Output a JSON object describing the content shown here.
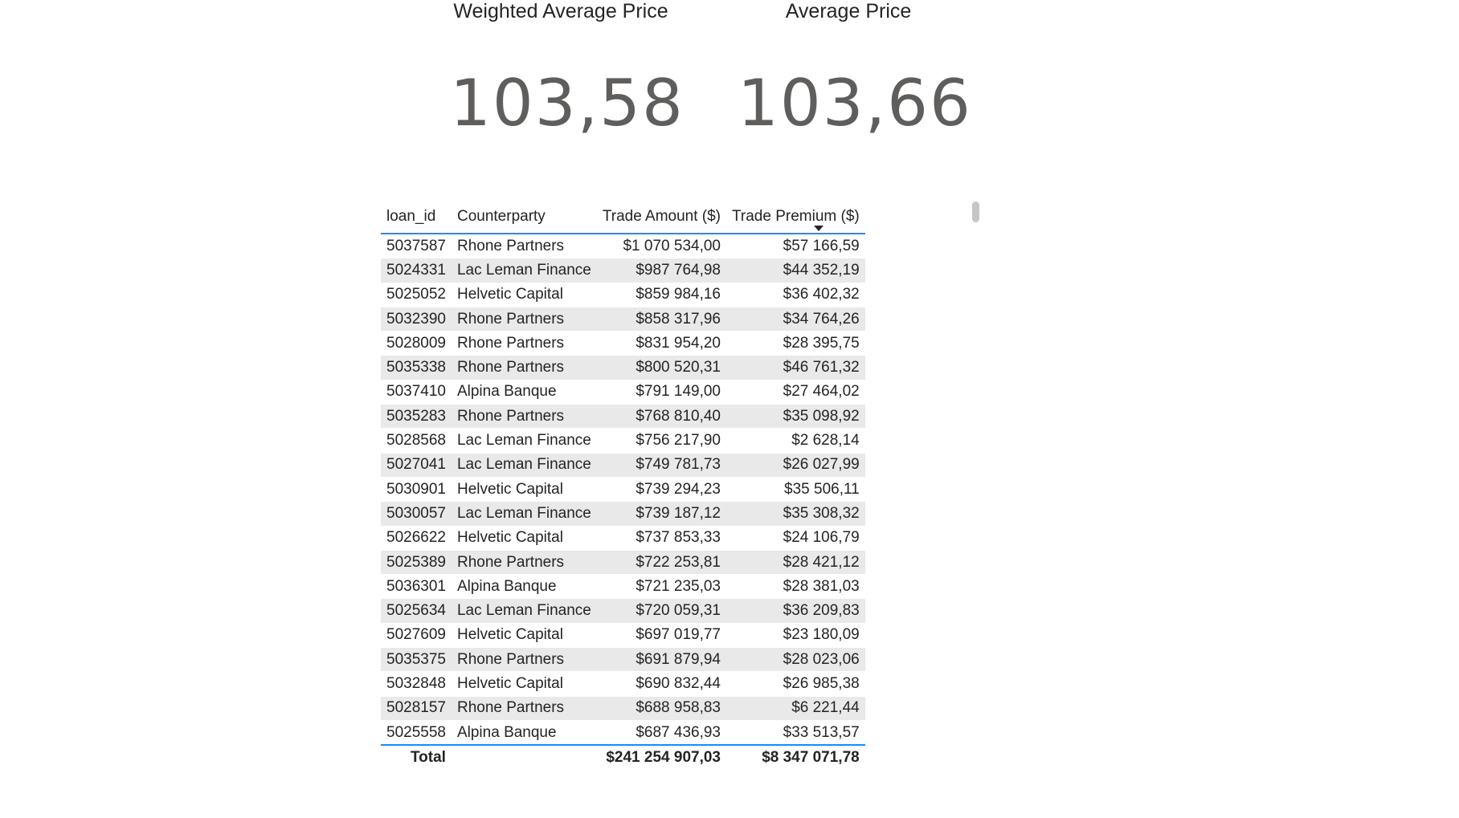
{
  "cards": {
    "weighted_average_price": {
      "title": "Weighted Average Price",
      "value": "103,58"
    },
    "average_price": {
      "title": "Average Price",
      "value": "103,66"
    }
  },
  "table": {
    "columns": [
      "loan_id",
      "Counterparty",
      "Trade Amount ($)",
      "Trade Premium ($)"
    ],
    "sort": {
      "column": "Trade Amount ($)",
      "direction": "descending",
      "icon": "sort-descending-icon"
    },
    "rows": [
      [
        "5037587",
        "Rhone Partners",
        "$1 070 534,00",
        "$57 166,59"
      ],
      [
        "5024331",
        "Lac Leman Finance",
        "$987 764,98",
        "$44 352,19"
      ],
      [
        "5025052",
        "Helvetic Capital",
        "$859 984,16",
        "$36 402,32"
      ],
      [
        "5032390",
        "Rhone Partners",
        "$858 317,96",
        "$34 764,26"
      ],
      [
        "5028009",
        "Rhone Partners",
        "$831 954,20",
        "$28 395,75"
      ],
      [
        "5035338",
        "Rhone Partners",
        "$800 520,31",
        "$46 761,32"
      ],
      [
        "5037410",
        "Alpina Banque",
        "$791 149,00",
        "$27 464,02"
      ],
      [
        "5035283",
        "Rhone Partners",
        "$768 810,40",
        "$35 098,92"
      ],
      [
        "5028568",
        "Lac Leman Finance",
        "$756 217,90",
        "$2 628,14"
      ],
      [
        "5027041",
        "Lac Leman Finance",
        "$749 781,73",
        "$26 027,99"
      ],
      [
        "5030901",
        "Helvetic Capital",
        "$739 294,23",
        "$35 506,11"
      ],
      [
        "5030057",
        "Lac Leman Finance",
        "$739 187,12",
        "$35 308,32"
      ],
      [
        "5026622",
        "Helvetic Capital",
        "$737 853,33",
        "$24 106,79"
      ],
      [
        "5025389",
        "Rhone Partners",
        "$722 253,81",
        "$28 421,12"
      ],
      [
        "5036301",
        "Alpina Banque",
        "$721 235,03",
        "$28 381,03"
      ],
      [
        "5025634",
        "Lac Leman Finance",
        "$720 059,31",
        "$36 209,83"
      ],
      [
        "5027609",
        "Helvetic Capital",
        "$697 019,77",
        "$23 180,09"
      ],
      [
        "5035375",
        "Rhone Partners",
        "$691 879,94",
        "$28 023,06"
      ],
      [
        "5032848",
        "Helvetic Capital",
        "$690 832,44",
        "$26 985,38"
      ],
      [
        "5028157",
        "Rhone Partners",
        "$688 958,83",
        "$6 221,44"
      ],
      [
        "5025558",
        "Alpina Banque",
        "$687 436,93",
        "$33 513,57"
      ]
    ],
    "total": {
      "label": "Total",
      "trade_amount": "$241 254 907,03",
      "trade_premium": "$8 347 071,78"
    }
  },
  "colors": {
    "header_rule": "#118dff",
    "band": "#e9e9e9",
    "card_value": "#605e5c",
    "scrollbar": "#c8c6c4"
  }
}
